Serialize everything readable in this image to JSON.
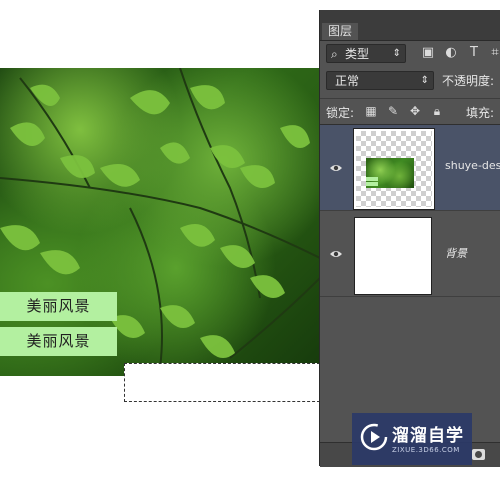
{
  "canvas": {
    "captions": [
      "美丽风景",
      "美丽风景"
    ]
  },
  "layers_panel": {
    "tab_label": "图层",
    "filter": {
      "kind_label": "类型",
      "search_icon": "search-icon"
    },
    "blend_mode": "正常",
    "opacity_label": "不透明度:",
    "lock_label": "锁定:",
    "fill_label": "填充:",
    "layers": [
      {
        "name": "shuye-desk",
        "visible": true,
        "selected": true
      },
      {
        "name": "背景",
        "visible": true,
        "selected": false
      }
    ]
  },
  "watermark": {
    "title": "溜溜自学",
    "url": "ZIXUE.3D66.COM"
  },
  "colors": {
    "caption_bg": "#b3f0a0",
    "panel_bg": "#535353",
    "selected_layer_bg": "#4a5368",
    "watermark_bg": "#2b3a68"
  }
}
